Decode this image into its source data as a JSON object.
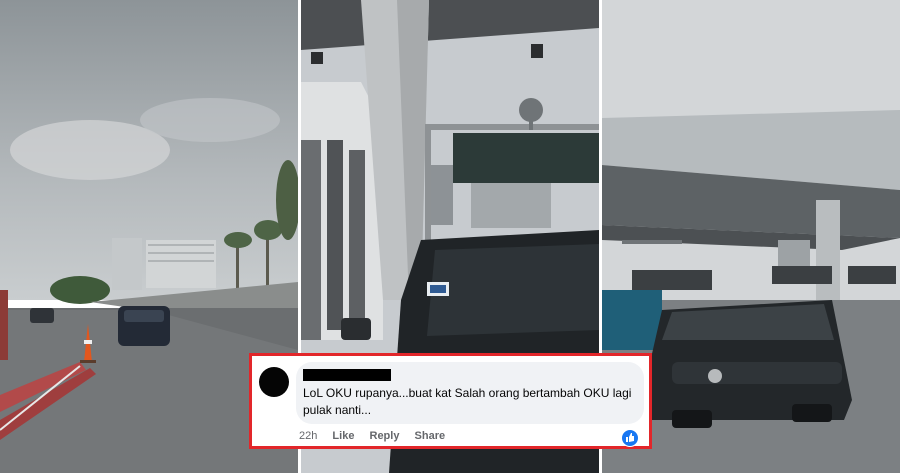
{
  "comment": {
    "author": "",
    "text": "LoL OKU rupanya...buat kat Salah orang bertambah OKU lagi pulak nanti...",
    "time": "22h",
    "actions": {
      "like": "Like",
      "reply": "Reply",
      "share": "Share"
    },
    "reaction_icon": "thumbs-up-icon",
    "accent": "#e2262a",
    "reaction_color": "#1877f2"
  },
  "panels": [
    {
      "label": "road-ramp-scene"
    },
    {
      "label": "toll-booth-closeup"
    },
    {
      "label": "toll-plaza-scene"
    }
  ]
}
